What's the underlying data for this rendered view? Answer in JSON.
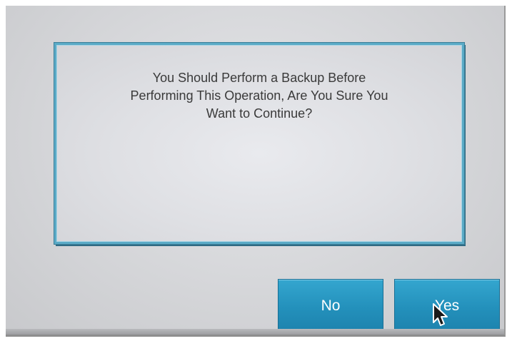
{
  "dialog": {
    "message": "You Should Perform a Backup Before\nPerforming This Operation, Are You Sure You\nWant to Continue?"
  },
  "buttons": {
    "no_label": "No",
    "yes_label": "Yes"
  },
  "colors": {
    "button_blue": "#2390bb",
    "box_border": "#5aaac6",
    "background_gray": "#d8d9dc"
  },
  "icons": {
    "cursor": "mouse-pointer-icon"
  }
}
